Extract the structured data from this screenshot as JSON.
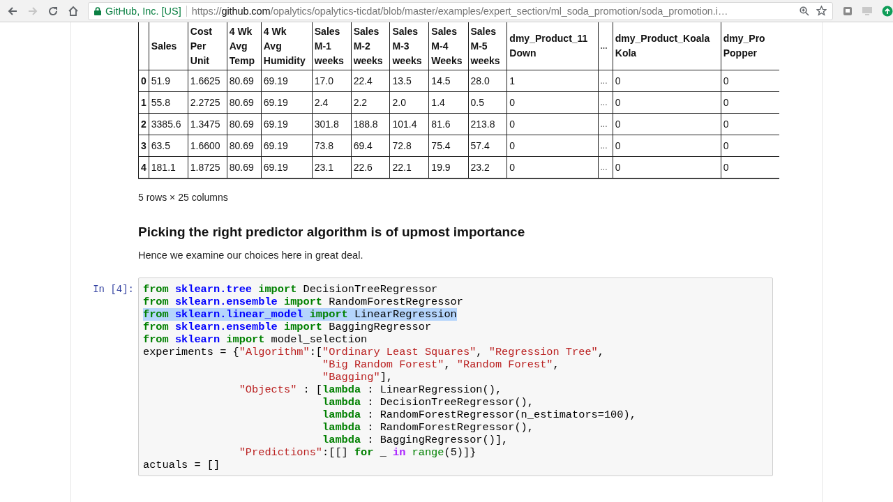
{
  "browser": {
    "site_identity": "GitHub, Inc. [US]",
    "url_scheme": "https://",
    "url_host": "github.com",
    "url_path": "/opalytics/opalytics-ticdat/blob/master/examples/expert_section/ml_soda_promotion/soda_promotion.i…",
    "back_enabled": true,
    "forward_enabled": false
  },
  "table": {
    "columns": [
      "",
      "Sales",
      "Cost\nPer\nUnit",
      "4 Wk\nAvg\nTemp",
      "4 Wk\nAvg\nHumidity",
      "Sales\nM-1\nweeks",
      "Sales\nM-2\nweeks",
      "Sales\nM-3\nweeks",
      "Sales\nM-4\nWeeks",
      "Sales\nM-5\nweeks",
      "dmy_Product_11\nDown",
      "...",
      "dmy_Product_Koala\nKola",
      "dmy_Pro\nPopper"
    ],
    "rows": [
      [
        "0",
        "51.9",
        "1.6625",
        "80.69",
        "69.19",
        "17.0",
        "22.4",
        "13.5",
        "14.5",
        "28.0",
        "1",
        "...",
        "0",
        "0"
      ],
      [
        "1",
        "55.8",
        "2.2725",
        "80.69",
        "69.19",
        "2.4",
        "2.2",
        "2.0",
        "1.4",
        "0.5",
        "0",
        "...",
        "0",
        "0"
      ],
      [
        "2",
        "3385.6",
        "1.3475",
        "80.69",
        "69.19",
        "301.8",
        "188.8",
        "101.4",
        "81.6",
        "213.8",
        "0",
        "...",
        "0",
        "0"
      ],
      [
        "3",
        "63.5",
        "1.6600",
        "80.69",
        "69.19",
        "73.8",
        "69.4",
        "72.8",
        "75.4",
        "57.4",
        "0",
        "...",
        "0",
        "0"
      ],
      [
        "4",
        "181.1",
        "1.8725",
        "80.69",
        "69.19",
        "23.1",
        "22.6",
        "22.1",
        "19.9",
        "23.2",
        "0",
        "...",
        "0",
        "0"
      ]
    ],
    "shape_note": "5 rows × 25 columns"
  },
  "heading": "Picking the right predictor algorithm is of upmost importance",
  "paragraph": "Hence we examine our choices here in great deal.",
  "code_cell": {
    "prompt": "In [4]:",
    "lines": [
      {
        "selected": false,
        "tokens": [
          {
            "kind": "kw",
            "text": "from"
          },
          {
            "kind": "mod",
            "text": " sklearn.tree "
          },
          {
            "kind": "kw",
            "text": "import"
          },
          {
            "kind": "plain",
            "text": " DecisionTreeRegressor"
          }
        ]
      },
      {
        "selected": false,
        "tokens": [
          {
            "kind": "kw",
            "text": "from"
          },
          {
            "kind": "mod",
            "text": " sklearn.ensemble "
          },
          {
            "kind": "kw",
            "text": "import"
          },
          {
            "kind": "plain",
            "text": " RandomForestRegressor"
          }
        ]
      },
      {
        "selected": true,
        "tokens": [
          {
            "kind": "kw",
            "text": "from"
          },
          {
            "kind": "mod",
            "text": " sklearn.linear_model "
          },
          {
            "kind": "kw",
            "text": "import"
          },
          {
            "kind": "plain",
            "text": " LinearRegression"
          }
        ]
      },
      {
        "selected": false,
        "tokens": [
          {
            "kind": "kw",
            "text": "from"
          },
          {
            "kind": "mod",
            "text": " sklearn.ensemble "
          },
          {
            "kind": "kw",
            "text": "import"
          },
          {
            "kind": "plain",
            "text": " BaggingRegressor"
          }
        ]
      },
      {
        "selected": false,
        "tokens": [
          {
            "kind": "kw",
            "text": "from"
          },
          {
            "kind": "mod",
            "text": " sklearn "
          },
          {
            "kind": "kw",
            "text": "import"
          },
          {
            "kind": "plain",
            "text": " model_selection"
          }
        ]
      },
      {
        "selected": false,
        "tokens": [
          {
            "kind": "plain",
            "text": "experiments = {"
          },
          {
            "kind": "str",
            "text": "\"Algorithm\""
          },
          {
            "kind": "plain",
            "text": ":["
          },
          {
            "kind": "str",
            "text": "\"Ordinary Least Squares\""
          },
          {
            "kind": "plain",
            "text": ", "
          },
          {
            "kind": "str",
            "text": "\"Regression Tree\""
          },
          {
            "kind": "plain",
            "text": ","
          }
        ]
      },
      {
        "selected": false,
        "tokens": [
          {
            "kind": "str",
            "text": "                            \"Big Random Forest\""
          },
          {
            "kind": "plain",
            "text": ", "
          },
          {
            "kind": "str",
            "text": "\"Random Forest\""
          },
          {
            "kind": "plain",
            "text": ","
          }
        ]
      },
      {
        "selected": false,
        "tokens": [
          {
            "kind": "str",
            "text": "                            \"Bagging\""
          },
          {
            "kind": "plain",
            "text": "],"
          }
        ]
      },
      {
        "selected": false,
        "tokens": [
          {
            "kind": "str",
            "text": "               \"Objects\""
          },
          {
            "kind": "plain",
            "text": " : ["
          },
          {
            "kind": "kw",
            "text": "lambda"
          },
          {
            "kind": "plain",
            "text": " : LinearRegression(),"
          }
        ]
      },
      {
        "selected": false,
        "tokens": [
          {
            "kind": "kw",
            "text": "                            lambda"
          },
          {
            "kind": "plain",
            "text": " : DecisionTreeRegressor(),"
          }
        ]
      },
      {
        "selected": false,
        "tokens": [
          {
            "kind": "kw",
            "text": "                            lambda"
          },
          {
            "kind": "plain",
            "text": " : RandomForestRegressor(n_estimators=100),"
          }
        ]
      },
      {
        "selected": false,
        "tokens": [
          {
            "kind": "kw",
            "text": "                            lambda"
          },
          {
            "kind": "plain",
            "text": " : RandomForestRegressor(),"
          }
        ]
      },
      {
        "selected": false,
        "tokens": [
          {
            "kind": "kw",
            "text": "                            lambda"
          },
          {
            "kind": "plain",
            "text": " : BaggingRegressor()],"
          }
        ]
      },
      {
        "selected": false,
        "tokens": [
          {
            "kind": "str",
            "text": "               \"Predictions\""
          },
          {
            "kind": "plain",
            "text": ":[[] "
          },
          {
            "kind": "kw",
            "text": "for"
          },
          {
            "kind": "plain",
            "text": " _ "
          },
          {
            "kind": "opword",
            "text": "in"
          },
          {
            "kind": "builtin",
            "text": " range"
          },
          {
            "kind": "plain",
            "text": "(5)]}"
          }
        ]
      },
      {
        "selected": false,
        "tokens": [
          {
            "kind": "plain",
            "text": "actuals = []"
          }
        ]
      }
    ]
  }
}
